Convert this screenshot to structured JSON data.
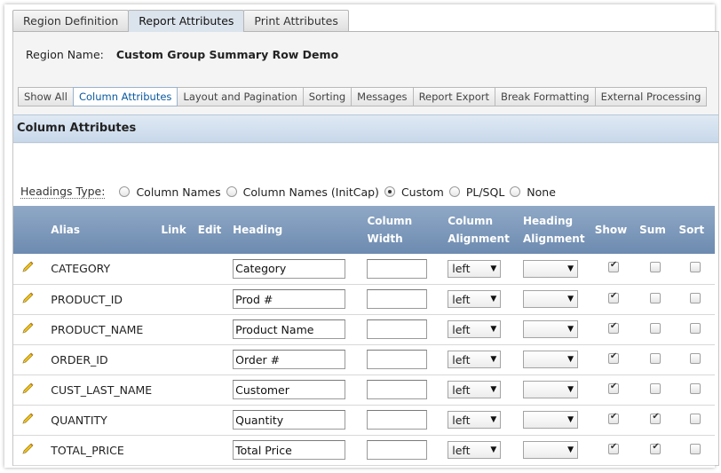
{
  "top_tabs": [
    {
      "label": "Region Definition",
      "active": false
    },
    {
      "label": "Report Attributes",
      "active": true
    },
    {
      "label": "Print Attributes",
      "active": false
    }
  ],
  "region": {
    "label": "Region Name:",
    "value": "Custom Group Summary Row Demo"
  },
  "sub_tabs": [
    {
      "label": "Show All"
    },
    {
      "label": "Column Attributes"
    },
    {
      "label": "Layout and Pagination"
    },
    {
      "label": "Sorting"
    },
    {
      "label": "Messages"
    },
    {
      "label": "Report Export"
    },
    {
      "label": "Break Formatting"
    },
    {
      "label": "External Processing"
    }
  ],
  "section": {
    "title": "Column Attributes"
  },
  "headings_type": {
    "label": "Headings Type:",
    "options": [
      "Column Names",
      "Column Names (InitCap)",
      "Custom",
      "PL/SQL",
      "None"
    ],
    "selected": "Custom"
  },
  "table": {
    "headers": {
      "alias": "Alias",
      "link": "Link",
      "edit": "Edit",
      "heading": "Heading",
      "col_width_1": "Column",
      "col_width_2": "Width",
      "col_align_1": "Column",
      "col_align_2": "Alignment",
      "head_align_1": "Heading",
      "head_align_2": "Alignment",
      "show": "Show",
      "sum": "Sum",
      "sort": "Sort"
    },
    "rows": [
      {
        "alias": "CATEGORY",
        "heading": "Category",
        "align": "left",
        "show": true,
        "sum": false,
        "sort": false
      },
      {
        "alias": "PRODUCT_ID",
        "heading": "Prod #",
        "align": "left",
        "show": true,
        "sum": false,
        "sort": false
      },
      {
        "alias": "PRODUCT_NAME",
        "heading": "Product Name",
        "align": "left",
        "show": true,
        "sum": false,
        "sort": false
      },
      {
        "alias": "ORDER_ID",
        "heading": "Order #",
        "align": "left",
        "show": true,
        "sum": false,
        "sort": false
      },
      {
        "alias": "CUST_LAST_NAME",
        "heading": "Customer",
        "align": "left",
        "show": true,
        "sum": false,
        "sort": false
      },
      {
        "alias": "QUANTITY",
        "heading": "Quantity",
        "align": "left",
        "show": true,
        "sum": true,
        "sort": false
      },
      {
        "alias": "TOTAL_PRICE",
        "heading": "Total Price",
        "align": "left",
        "show": true,
        "sum": true,
        "sort": false
      }
    ]
  },
  "icons": {
    "edit_row": "pencil-icon"
  },
  "colors": {
    "header_bg": "#7b97ba",
    "section_bg": "#d3e0ef",
    "active_subtab_text": "#0a5aa0"
  }
}
